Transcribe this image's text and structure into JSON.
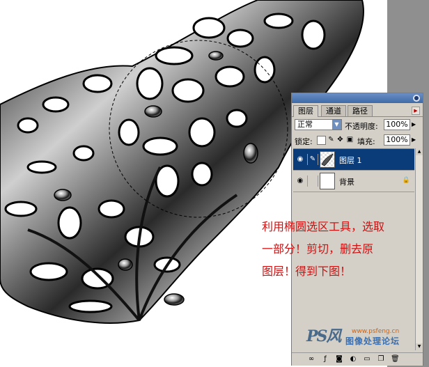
{
  "layers_panel": {
    "tabs": [
      {
        "label": "图层",
        "active": true
      },
      {
        "label": "通道",
        "active": false
      },
      {
        "label": "路径",
        "active": false
      }
    ],
    "blend_mode": "正常",
    "opacity_label": "不透明度:",
    "opacity_value": "100%",
    "lock_label": "锁定:",
    "fill_label": "填充:",
    "fill_value": "100%",
    "layers": [
      {
        "name": "图层 1",
        "selected": true,
        "visible": true
      },
      {
        "name": "背景",
        "selected": false,
        "visible": true,
        "locked": true
      }
    ],
    "accent_color": "#0a3c7a"
  },
  "annotation": {
    "lines": [
      "利用椭圆选区工具，选取",
      "一部分！剪切，删去原",
      "图层！得到下图！"
    ],
    "color": "#d01010"
  },
  "watermark": {
    "url": "www.psfeng.cn",
    "name": "图像处理论坛"
  }
}
